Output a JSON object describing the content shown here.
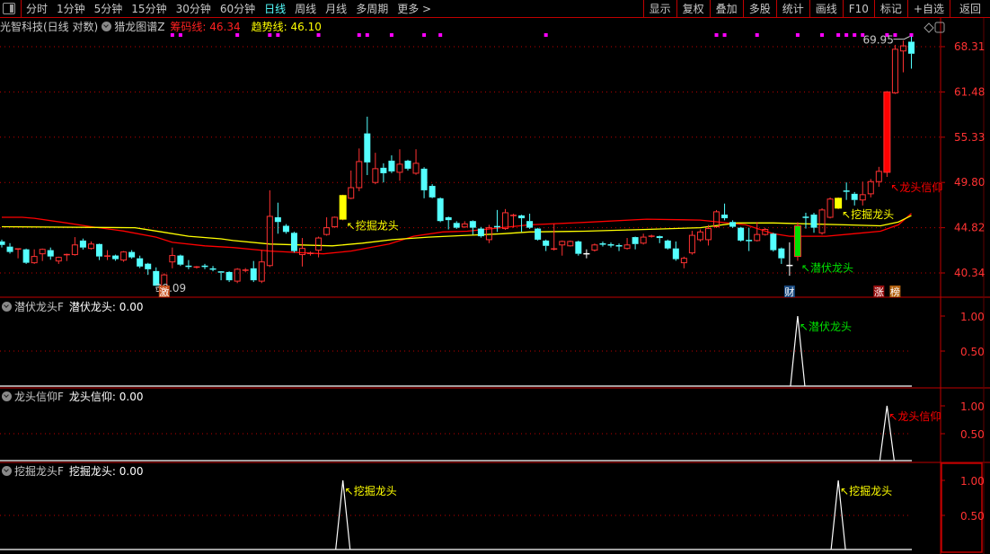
{
  "toolbar": {
    "periods": [
      {
        "label": "分时",
        "active": false
      },
      {
        "label": "1分钟",
        "active": false
      },
      {
        "label": "5分钟",
        "active": false
      },
      {
        "label": "15分钟",
        "active": false
      },
      {
        "label": "30分钟",
        "active": false
      },
      {
        "label": "60分钟",
        "active": false
      },
      {
        "label": "日线",
        "active": true
      },
      {
        "label": "周线",
        "active": false
      },
      {
        "label": "月线",
        "active": false
      },
      {
        "label": "多周期",
        "active": false
      },
      {
        "label": "更多 >",
        "active": false
      }
    ],
    "buttons": [
      "显示",
      "复权",
      "叠加",
      "多股",
      "统计",
      "画线",
      "F10",
      "标记",
      "+自选",
      "返回"
    ]
  },
  "header": {
    "stock": "光智科技(日线 对数)",
    "indicator": "猎龙图谱Z",
    "chip_line": "筹码线: 46.34",
    "trend_line": "趋势线: 46.10"
  },
  "colors": {
    "up": "#ff3232",
    "down": "#54ffff",
    "chip_line": "#ff0000",
    "trend_line": "#ffff00",
    "grid": "#c00000",
    "axis_text": "#ff3232",
    "dot": "#ff00ff",
    "signal_dig": "#ffff00",
    "signal_latent": "#00e000",
    "signal_faith": "#ff0000"
  },
  "chart_data": {
    "type": "candlestick",
    "scale": "log",
    "y_ticks": [
      40.34,
      44.82,
      49.8,
      55.33,
      61.48,
      68.31
    ],
    "y_tick_labels": [
      "40.34",
      "44.82",
      "49.80",
      "55.33",
      "61.48",
      "68.31"
    ],
    "ylim": [
      38.8,
      70.5
    ],
    "grid": true,
    "ohlc_order": "open, close, high, low",
    "candles": [
      [
        43.41,
        43.06,
        43.6,
        42.8
      ],
      [
        42.89,
        42.36,
        43.24,
        42.2
      ],
      [
        42.62,
        42.66,
        42.7,
        41.74
      ],
      [
        42.62,
        41.31,
        42.7,
        41.2
      ],
      [
        41.31,
        41.92,
        42.62,
        41.2
      ],
      [
        42.18,
        42.62,
        42.7,
        41.48
      ],
      [
        42.54,
        41.92,
        42.8,
        41.6
      ],
      [
        41.48,
        41.83,
        41.9,
        41.2
      ],
      [
        42.06,
        42.1,
        42.2,
        41.48
      ],
      [
        42.1,
        43.06,
        43.85,
        42.0
      ],
      [
        43.5,
        42.8,
        43.7,
        42.6
      ],
      [
        42.71,
        43.15,
        43.41,
        42.6
      ],
      [
        43.15,
        41.92,
        43.2,
        41.57
      ],
      [
        41.92,
        41.96,
        42.54,
        41.57
      ],
      [
        42.01,
        41.66,
        42.1,
        41.5
      ],
      [
        41.57,
        42.36,
        42.45,
        41.4
      ],
      [
        42.36,
        41.83,
        42.54,
        41.7
      ],
      [
        41.74,
        40.95,
        42.0,
        40.8
      ],
      [
        41.22,
        40.69,
        41.3,
        40.16
      ],
      [
        40.52,
        39.16,
        40.87,
        39.15
      ],
      [
        39.1,
        40.16,
        40.3,
        39.09
      ],
      [
        41.39,
        42.01,
        42.8,
        40.78
      ],
      [
        42.01,
        41.13,
        42.1,
        41.0
      ],
      [
        40.97,
        40.95,
        41.57,
        40.69
      ],
      [
        40.86,
        40.9,
        41.0,
        40.75
      ],
      [
        40.97,
        40.95,
        41.2,
        40.7
      ],
      [
        40.71,
        40.69,
        41.0,
        40.5
      ],
      [
        40.43,
        40.34,
        40.5,
        39.66
      ],
      [
        40.43,
        39.66,
        40.5,
        39.5
      ],
      [
        39.58,
        40.69,
        40.8,
        39.4
      ],
      [
        40.58,
        40.6,
        40.8,
        40.4
      ],
      [
        40.78,
        39.66,
        41.48,
        39.5
      ],
      [
        39.58,
        41.39,
        42.54,
        39.4
      ],
      [
        41.04,
        46.02,
        48.9,
        40.9
      ],
      [
        45.92,
        45.42,
        47.51,
        44.2
      ],
      [
        45.02,
        44.38,
        45.2,
        44.2
      ],
      [
        44.29,
        42.45,
        44.4,
        42.3
      ],
      [
        42.1,
        42.71,
        43.76,
        40.95
      ],
      [
        42.18,
        42.22,
        42.4,
        42.0
      ],
      [
        42.54,
        43.76,
        43.9,
        41.83
      ],
      [
        44.12,
        44.82,
        45.92,
        44.0
      ],
      [
        44.92,
        45.92,
        46.0,
        44.8
      ],
      [
        45.72,
        48.31,
        48.4,
        45.6
      ],
      [
        48.0,
        49.2,
        51.2,
        47.9
      ],
      [
        49.2,
        52.28,
        53.9,
        48.8
      ],
      [
        55.82,
        52.18,
        58.04,
        50.66
      ],
      [
        49.8,
        51.42,
        53.36,
        49.6
      ],
      [
        51.53,
        50.88,
        52.07,
        49.8
      ],
      [
        52.39,
        51.1,
        53.04,
        50.9
      ],
      [
        50.99,
        51.96,
        53.8,
        50.0
      ],
      [
        52.39,
        51.42,
        52.5,
        51.2
      ],
      [
        50.88,
        52.07,
        53.8,
        50.7
      ],
      [
        51.42,
        48.9,
        51.6,
        48.0
      ],
      [
        49.4,
        48.1,
        49.6,
        48.0
      ],
      [
        48.0,
        45.52,
        48.1,
        45.4
      ],
      [
        45.92,
        45.62,
        46.0,
        44.64
      ],
      [
        45.32,
        44.82,
        45.5,
        44.7
      ],
      [
        44.9,
        45.22,
        45.5,
        44.8
      ],
      [
        45.52,
        44.82,
        45.6,
        44.1
      ],
      [
        44.73,
        43.94,
        44.9,
        43.8
      ],
      [
        43.59,
        44.82,
        45.12,
        43.24
      ],
      [
        44.93,
        44.9,
        46.71,
        44.38
      ],
      [
        44.73,
        46.41,
        46.81,
        44.6
      ],
      [
        46.1,
        46.12,
        46.3,
        44.82
      ],
      [
        46.12,
        45.82,
        46.2,
        44.38
      ],
      [
        45.52,
        44.82,
        46.31,
        44.7
      ],
      [
        44.73,
        43.59,
        44.8,
        43.5
      ],
      [
        43.5,
        42.97,
        43.6,
        42.45
      ],
      [
        42.6,
        42.66,
        45.22,
        42.5
      ],
      [
        43.06,
        43.41,
        43.5,
        42.0
      ],
      [
        42.97,
        43.41,
        43.5,
        42.9
      ],
      [
        43.41,
        42.18,
        43.5,
        42.0
      ],
      [
        42.18,
        42.18,
        42.62,
        41.74
      ],
      [
        42.54,
        43.06,
        43.2,
        42.4
      ],
      [
        43.15,
        43.13,
        43.4,
        42.9
      ],
      [
        43.06,
        43.04,
        43.3,
        42.8
      ],
      [
        42.97,
        42.95,
        43.2,
        42.45
      ],
      [
        42.71,
        43.06,
        43.76,
        42.6
      ],
      [
        43.85,
        43.15,
        43.9,
        42.62
      ],
      [
        43.24,
        43.85,
        44.2,
        43.1
      ],
      [
        43.92,
        43.94,
        44.1,
        43.8
      ],
      [
        43.94,
        43.76,
        44.0,
        43.24
      ],
      [
        43.5,
        42.71,
        43.6,
        42.6
      ],
      [
        42.71,
        41.66,
        43.41,
        41.5
      ],
      [
        41.31,
        41.74,
        41.9,
        40.78
      ],
      [
        42.27,
        44.03,
        44.5,
        42.1
      ],
      [
        43.59,
        44.38,
        44.64,
        43.4
      ],
      [
        43.59,
        44.73,
        45.1,
        43.0
      ],
      [
        44.92,
        46.51,
        46.7,
        44.8
      ],
      [
        46.21,
        45.82,
        47.41,
        45.6
      ],
      [
        45.42,
        44.92,
        45.6,
        44.8
      ],
      [
        44.82,
        43.5,
        44.9,
        43.4
      ],
      [
        43.5,
        43.48,
        44.82,
        42.45
      ],
      [
        43.5,
        44.12,
        45.42,
        43.4
      ],
      [
        44.12,
        44.64,
        44.8,
        44.0
      ],
      [
        44.2,
        42.54,
        44.3,
        42.4
      ],
      [
        42.71,
        41.74,
        42.8,
        41.2
      ],
      [
        41.05,
        41.04,
        43.32,
        40.08
      ],
      [
        41.92,
        45.02,
        45.4,
        41.5
      ],
      [
        45.92,
        45.9,
        46.41,
        44.73
      ],
      [
        46.21,
        44.82,
        46.4,
        44.3
      ],
      [
        44.29,
        46.71,
        46.9,
        44.1
      ],
      [
        45.92,
        47.91,
        48.1,
        45.8
      ],
      [
        46.91,
        48.0,
        48.1,
        46.8
      ],
      [
        48.8,
        48.78,
        49.8,
        47.81
      ],
      [
        48.5,
        47.81,
        48.7,
        47.2
      ],
      [
        47.81,
        48.4,
        49.9,
        47.2
      ],
      [
        48.5,
        49.9,
        50.2,
        48.1
      ],
      [
        49.9,
        51.1,
        51.64,
        49.3
      ],
      [
        50.99,
        61.48,
        61.6,
        50.45
      ],
      [
        61.34,
        67.9,
        68.6,
        61.2
      ],
      [
        67.63,
        68.44,
        69.3,
        64.35
      ],
      [
        69.1,
        67.2,
        69.95,
        64.9
      ]
    ],
    "neutral_candles": [
      72,
      97
    ],
    "signal_candles": [
      {
        "index": 42,
        "type": "dig",
        "label": "挖掘龙头"
      },
      {
        "index": 98,
        "type": "latent",
        "label": "潜伏龙头"
      },
      {
        "index": 103,
        "type": "dig",
        "label": "挖掘龙头"
      },
      {
        "index": 109,
        "type": "faith",
        "label": "龙头信仰"
      }
    ],
    "series": [
      {
        "name": "筹码线",
        "last": 46.34,
        "points": [
          [
            0,
            45.92
          ],
          [
            2.5,
            45.92
          ],
          [
            4,
            45.82
          ],
          [
            8,
            45.32
          ],
          [
            11,
            44.92
          ],
          [
            15,
            44.48
          ],
          [
            19,
            43.85
          ],
          [
            21,
            43.32
          ],
          [
            25,
            42.97
          ],
          [
            28.5,
            42.8
          ],
          [
            33,
            42.45
          ],
          [
            39.6,
            42.18
          ],
          [
            43,
            42.45
          ],
          [
            47.7,
            43.15
          ],
          [
            50.7,
            43.94
          ],
          [
            54.3,
            44.38
          ],
          [
            57.3,
            44.46
          ],
          [
            65,
            45.12
          ],
          [
            72.8,
            45.42
          ],
          [
            79.4,
            45.72
          ],
          [
            86,
            45.62
          ],
          [
            91.6,
            45.12
          ],
          [
            95,
            44.2
          ],
          [
            97,
            43.94
          ],
          [
            101.5,
            43.94
          ],
          [
            104.9,
            44.2
          ],
          [
            108.2,
            44.46
          ],
          [
            110.4,
            45.12
          ],
          [
            112,
            46.34
          ]
        ]
      },
      {
        "name": "趋势线",
        "last": 46.1,
        "points": [
          [
            0,
            44.92
          ],
          [
            16.4,
            44.82
          ],
          [
            19.7,
            44.38
          ],
          [
            23,
            43.94
          ],
          [
            27,
            43.67
          ],
          [
            28.5,
            43.5
          ],
          [
            33,
            43.15
          ],
          [
            40.7,
            42.97
          ],
          [
            44.4,
            43.24
          ],
          [
            48.1,
            43.59
          ],
          [
            52.5,
            43.85
          ],
          [
            57.3,
            44.03
          ],
          [
            61.7,
            44.2
          ],
          [
            65,
            44.38
          ],
          [
            71.7,
            44.46
          ],
          [
            79.4,
            44.64
          ],
          [
            86,
            44.82
          ],
          [
            90.5,
            45.32
          ],
          [
            95,
            45.32
          ],
          [
            103.8,
            45.12
          ],
          [
            108.2,
            45.02
          ],
          [
            110.4,
            45.42
          ],
          [
            112,
            46.1
          ]
        ]
      }
    ],
    "top_dots": [
      21,
      22,
      29,
      33,
      34,
      39,
      44,
      45,
      48,
      52,
      54,
      67,
      88,
      89,
      93,
      98,
      101,
      103,
      104,
      105,
      106,
      109,
      110,
      112
    ],
    "annotations": {
      "high": {
        "index": 112,
        "text": "69.95"
      },
      "low": {
        "index": 20,
        "text": "39.09"
      },
      "dig1": {
        "index": 42,
        "text": "↖挖掘龙头"
      },
      "dig2": {
        "index": 103,
        "text": "↖挖掘龙头"
      },
      "latent": {
        "index": 98,
        "text": "↖潜伏龙头"
      },
      "faith": {
        "index": 109,
        "text": "↖龙头信仰"
      }
    },
    "badges": [
      {
        "index": 20,
        "text": "激",
        "color": "#c8501e"
      },
      {
        "index": 97,
        "text": "财",
        "color": "#1a4a80"
      },
      {
        "index": 108,
        "text": "涨",
        "color": "#9a1010"
      },
      {
        "index": 110,
        "text": "榜",
        "color": "#b0600e"
      }
    ]
  },
  "sub_panels": [
    {
      "title": "潜伏龙头F",
      "value_label": "潜伏龙头: 0.00",
      "spikes": [
        98
      ],
      "spike_label": "↖潜伏龙头",
      "label_color": "#00e000",
      "ticks": [
        "1.00",
        "0.50"
      ]
    },
    {
      "title": "龙头信仰F",
      "value_label": "龙头信仰: 0.00",
      "spikes": [
        109
      ],
      "spike_label": "↖龙头信仰",
      "label_color": "#ff0000",
      "ticks": [
        "1.00",
        "0.50"
      ]
    },
    {
      "title": "挖掘龙头F",
      "value_label": "挖掘龙头: 0.00",
      "spikes": [
        42,
        103
      ],
      "spike_label": "↖挖掘龙头",
      "label_color": "#ffff00",
      "ticks": [
        "1.00",
        "0.50"
      ]
    }
  ]
}
